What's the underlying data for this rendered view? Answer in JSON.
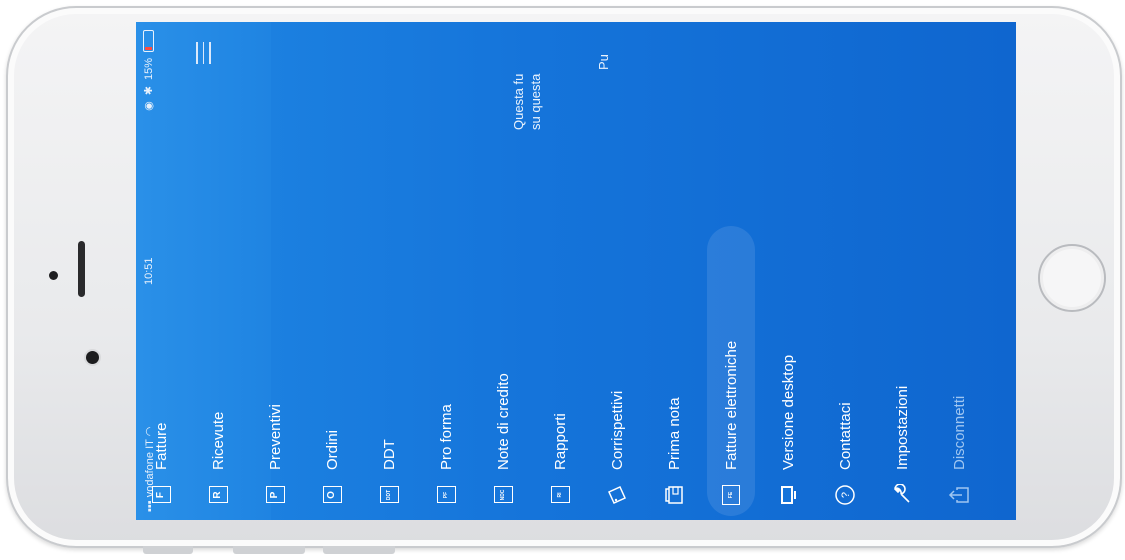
{
  "status_bar": {
    "carrier": "vodafone IT",
    "time": "10:51",
    "battery": "15%"
  },
  "header": {
    "menu_icon": "hamburger-icon",
    "description_line1": "Questa fu",
    "description_line2": "su questa",
    "description_line3": "Pu"
  },
  "menu": {
    "items": [
      {
        "label": "Fatture",
        "icon": "fatture-icon",
        "glyph": "F"
      },
      {
        "label": "Ricevute",
        "icon": "ricevute-icon",
        "glyph": "R"
      },
      {
        "label": "Preventivi",
        "icon": "preventivi-icon",
        "glyph": "P"
      },
      {
        "label": "Ordini",
        "icon": "ordini-icon",
        "glyph": "O"
      },
      {
        "label": "DDT",
        "icon": "ddt-icon",
        "glyph": "DDT"
      },
      {
        "label": "Pro forma",
        "icon": "pro-forma-icon",
        "glyph": "PF"
      },
      {
        "label": "Note di credito",
        "icon": "note-di-credito-icon",
        "glyph": "NDC"
      },
      {
        "label": "Rapporti",
        "icon": "rapporti-icon",
        "glyph": "RI"
      },
      {
        "label": "Corrispettivi",
        "icon": "ticket-icon"
      },
      {
        "label": "Prima nota",
        "icon": "wallet-icon"
      },
      {
        "label": "Fatture elettroniche",
        "icon": "fattura-elettronica-icon",
        "glyph": "FE",
        "selected": true
      },
      {
        "label": "Versione desktop",
        "icon": "desktop-icon"
      },
      {
        "label": "Contattaci",
        "icon": "help-icon",
        "glyph": "?"
      },
      {
        "label": "Impostazioni",
        "icon": "wrench-icon"
      },
      {
        "label": "Disconnetti",
        "icon": "share-icon"
      }
    ]
  },
  "colors": {
    "accent": "#1574da",
    "header": "#2a90e8",
    "battery_low": "#ff4b3e"
  }
}
